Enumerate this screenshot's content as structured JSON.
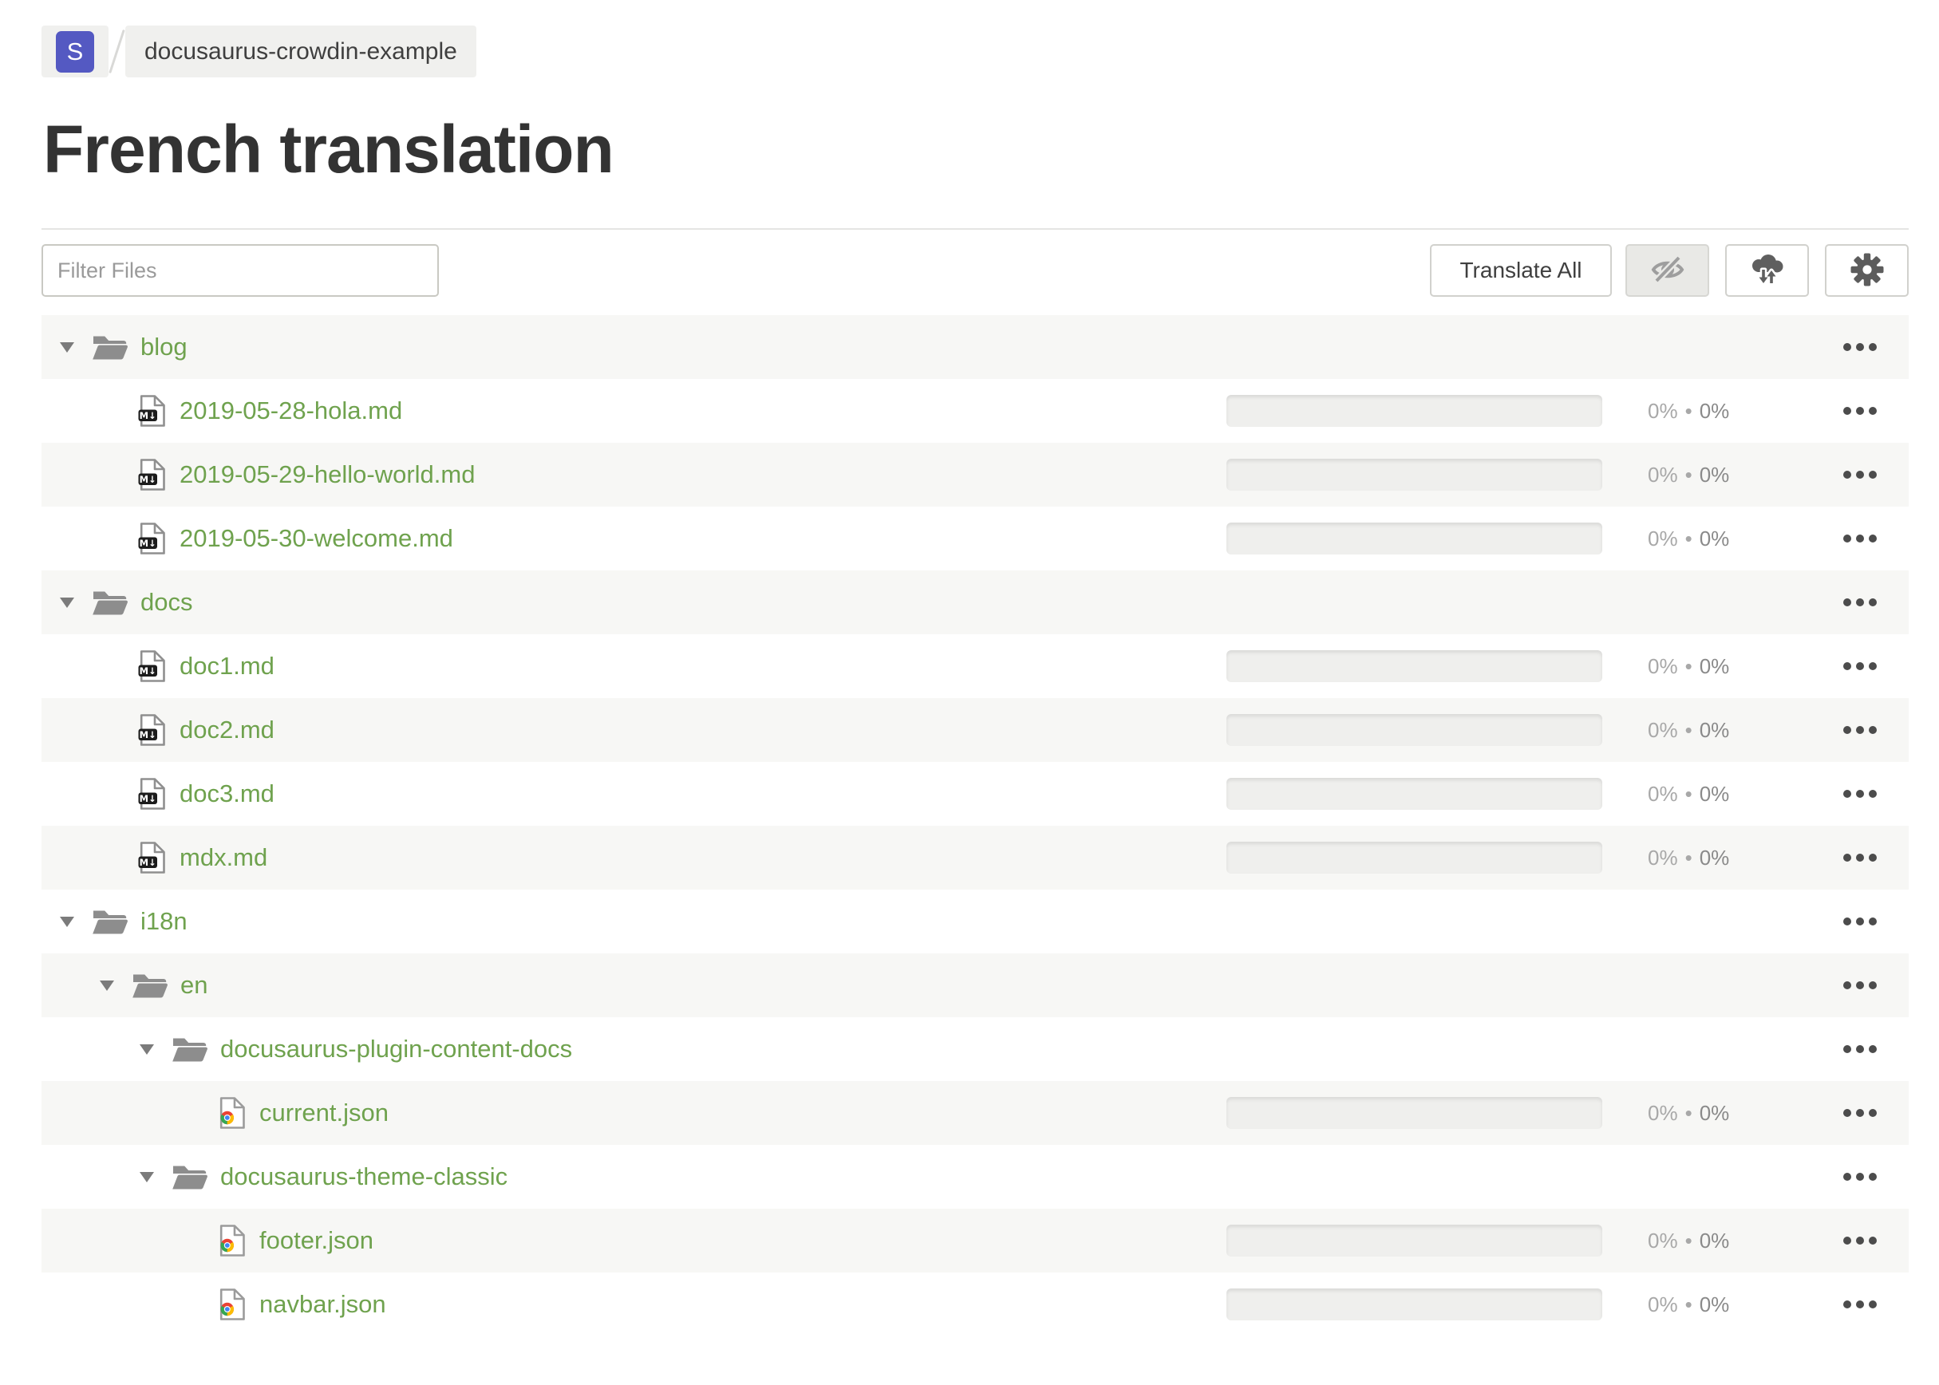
{
  "breadcrumb": {
    "workspace_initial": "S",
    "project_name": "docusaurus-crowdin-example"
  },
  "page": {
    "title": "French translation"
  },
  "toolbar": {
    "filter_placeholder": "Filter Files",
    "translate_all_label": "Translate All",
    "buttons": [
      "hidden-strings-toggle",
      "cloud-sync",
      "settings"
    ]
  },
  "tree": {
    "percent_separator": "•",
    "rows": [
      {
        "type": "folder",
        "level": 0,
        "label": "blog",
        "expanded": true
      },
      {
        "type": "file",
        "file_type": "md",
        "level": 1,
        "label": "2019-05-28-hola.md",
        "translated": "0%",
        "approved": "0%"
      },
      {
        "type": "file",
        "file_type": "md",
        "level": 1,
        "label": "2019-05-29-hello-world.md",
        "translated": "0%",
        "approved": "0%"
      },
      {
        "type": "file",
        "file_type": "md",
        "level": 1,
        "label": "2019-05-30-welcome.md",
        "translated": "0%",
        "approved": "0%"
      },
      {
        "type": "folder",
        "level": 0,
        "label": "docs",
        "expanded": true
      },
      {
        "type": "file",
        "file_type": "md",
        "level": 1,
        "label": "doc1.md",
        "translated": "0%",
        "approved": "0%"
      },
      {
        "type": "file",
        "file_type": "md",
        "level": 1,
        "label": "doc2.md",
        "translated": "0%",
        "approved": "0%"
      },
      {
        "type": "file",
        "file_type": "md",
        "level": 1,
        "label": "doc3.md",
        "translated": "0%",
        "approved": "0%"
      },
      {
        "type": "file",
        "file_type": "md",
        "level": 1,
        "label": "mdx.md",
        "translated": "0%",
        "approved": "0%"
      },
      {
        "type": "folder",
        "level": 0,
        "label": "i18n",
        "expanded": true
      },
      {
        "type": "folder",
        "level": 1,
        "label": "en",
        "expanded": true
      },
      {
        "type": "folder",
        "level": 2,
        "label": "docusaurus-plugin-content-docs",
        "expanded": true
      },
      {
        "type": "file",
        "file_type": "json",
        "level": 3,
        "label": "current.json",
        "translated": "0%",
        "approved": "0%"
      },
      {
        "type": "folder",
        "level": 2,
        "label": "docusaurus-theme-classic",
        "expanded": true
      },
      {
        "type": "file",
        "file_type": "json",
        "level": 3,
        "label": "footer.json",
        "translated": "0%",
        "approved": "0%"
      },
      {
        "type": "file",
        "file_type": "json",
        "level": 3,
        "label": "navbar.json",
        "translated": "0%",
        "approved": "0%"
      }
    ]
  },
  "colors": {
    "accent_green": "#6fa24e",
    "badge_indigo": "#5459c2",
    "row_stripe": "#f7f7f5",
    "folder_gray": "#8d8d8d",
    "title_text": "#333333"
  }
}
